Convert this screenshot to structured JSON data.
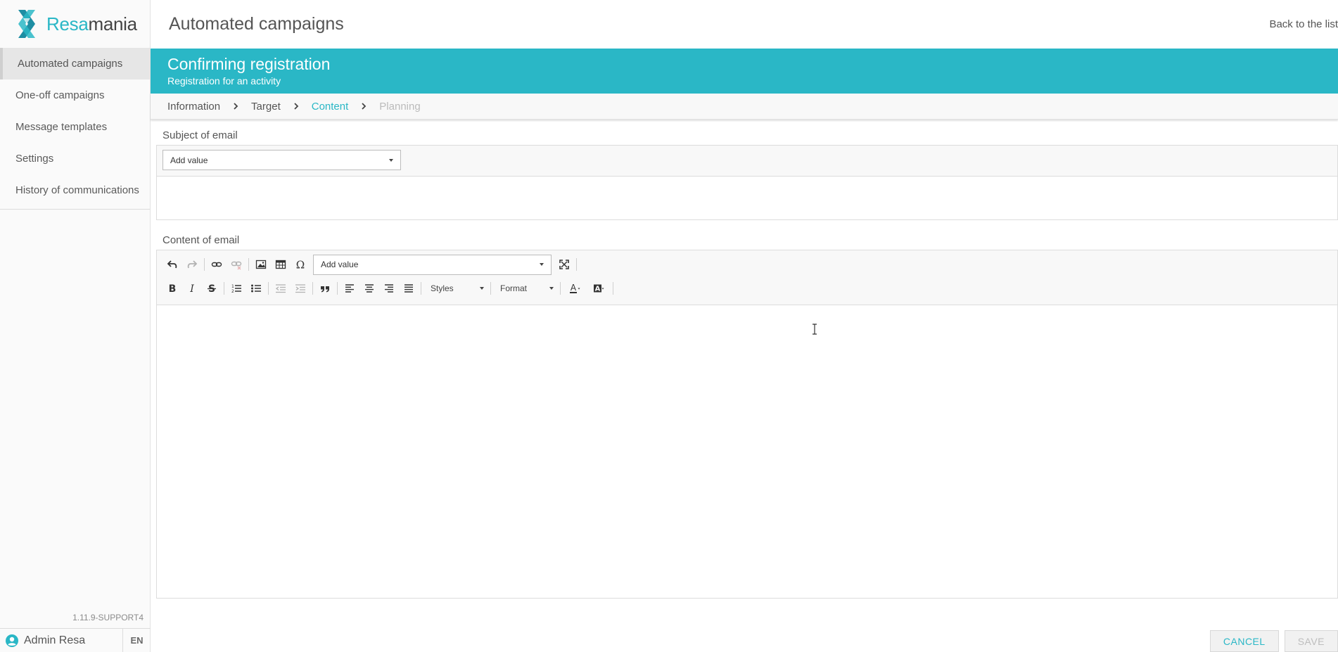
{
  "app": {
    "logo_prefix": "Resa",
    "logo_suffix": "mania",
    "accent_color": "#2ab7c6",
    "version": "1.11.9-SUPPORT4"
  },
  "sidebar": {
    "items": [
      {
        "label": "Automated campaigns",
        "active": true
      },
      {
        "label": "One-off campaigns"
      },
      {
        "label": "Message templates"
      },
      {
        "label": "Settings"
      },
      {
        "label": "History of communications"
      }
    ]
  },
  "user": {
    "name": "Admin Resa",
    "icon": "user-circle-icon",
    "language": "EN"
  },
  "header": {
    "title": "Automated campaigns",
    "back_link": "Back to the list"
  },
  "banner": {
    "title": "Confirming registration",
    "subtitle": "Registration for an activity"
  },
  "steps": [
    {
      "label": "Information",
      "state": "done"
    },
    {
      "label": "Target",
      "state": "done"
    },
    {
      "label": "Content",
      "state": "current"
    },
    {
      "label": "Planning",
      "state": "disabled"
    }
  ],
  "subject": {
    "label": "Subject of email",
    "add_value": "Add value",
    "value": ""
  },
  "content": {
    "label": "Content of email",
    "add_value": "Add value",
    "styles_label": "Styles",
    "format_label": "Format",
    "value": ""
  },
  "footer": {
    "cancel_label": "CANCEL",
    "save_label": "SAVE"
  }
}
